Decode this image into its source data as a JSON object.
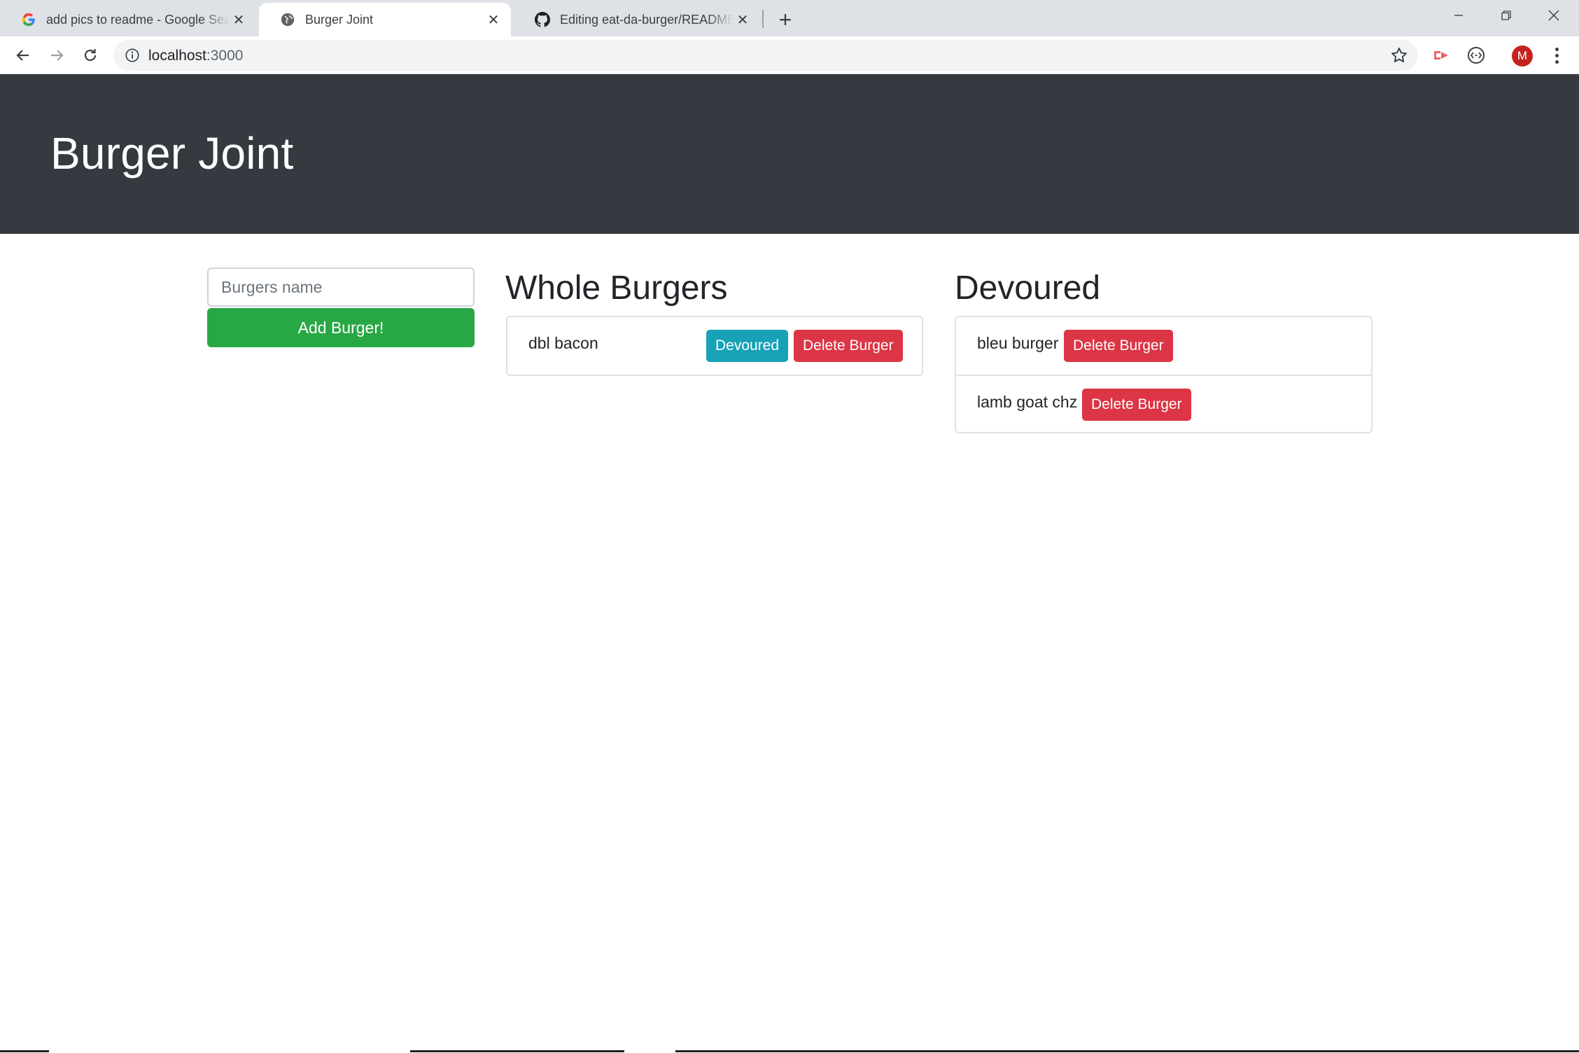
{
  "browser": {
    "tabs": [
      {
        "title": "add pics to readme - Google Search",
        "favicon": "google-g-icon",
        "active": false
      },
      {
        "title": "Burger Joint",
        "favicon": "globe-icon",
        "active": true
      },
      {
        "title": "Editing eat-da-burger/README.md",
        "favicon": "github-icon",
        "active": false
      }
    ],
    "address": {
      "host": "localhost",
      "port": ":3000"
    },
    "profile_initial": "M",
    "accent_colors": {
      "tab_strip": "#dee1e6",
      "avatar": "#c5221f"
    }
  },
  "page": {
    "header_title": "Burger Joint",
    "form": {
      "input_placeholder": "Burgers name",
      "add_button_label": "Add Burger!"
    },
    "whole": {
      "heading": "Whole Burgers",
      "items": [
        {
          "name": "dbl bacon",
          "devour_label": "Devoured",
          "delete_label": "Delete Burger"
        }
      ]
    },
    "devoured": {
      "heading": "Devoured",
      "items": [
        {
          "name": "bleu burger",
          "delete_label": "Delete Burger"
        },
        {
          "name": "lamb goat chz",
          "delete_label": "Delete Burger"
        }
      ]
    },
    "colors": {
      "jumbotron": "#343a40",
      "success": "#28a745",
      "info": "#17a2b8",
      "danger": "#dc3545"
    }
  }
}
